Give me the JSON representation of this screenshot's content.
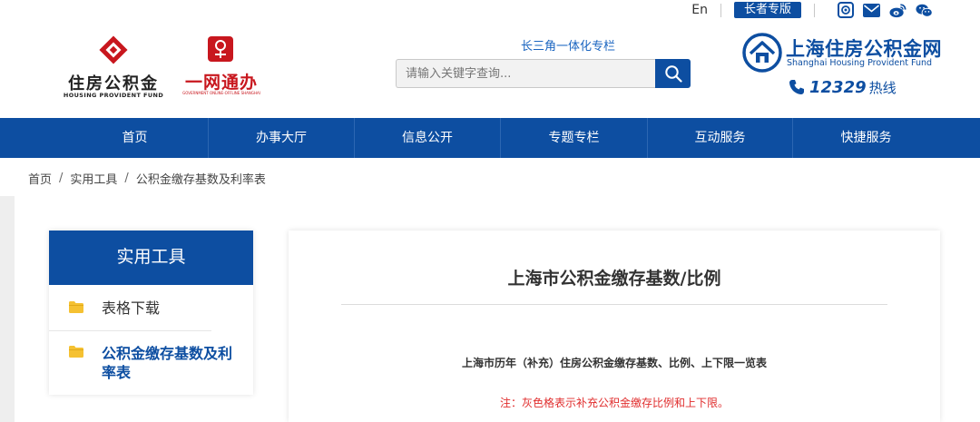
{
  "top_bar": {
    "language_link": "En",
    "elderly_mode_label": "长者专版",
    "icons": [
      "app-icon",
      "mail-icon",
      "weibo-icon",
      "wechat-icon"
    ]
  },
  "header": {
    "left_logo": {
      "cn": "住房公积金",
      "en": "HOUSING PROVIDENT FUND"
    },
    "ywtb_logo": {
      "cn": "一网通办",
      "en": "GOVERNMENT ONLINE-OFFLINE SHANGHAI"
    },
    "yrd_link": "长三角一体化专栏",
    "search": {
      "placeholder": "请输入关键字查询..."
    },
    "right_logo": {
      "cn": "上海住房公积金网",
      "en": "Shanghai Housing Provident Fund"
    },
    "hotline": {
      "number": "12329",
      "label": "热线"
    }
  },
  "nav": {
    "items": [
      "首页",
      "办事大厅",
      "信息公开",
      "专题专栏",
      "互动服务",
      "快捷服务"
    ]
  },
  "breadcrumb": {
    "items": [
      "首页",
      "实用工具",
      "公积金缴存基数及利率表"
    ],
    "separator": "/"
  },
  "sidebar": {
    "title": "实用工具",
    "items": [
      {
        "label": "表格下载",
        "active": false
      },
      {
        "label": "公积金缴存基数及利率表",
        "active": true
      }
    ]
  },
  "main": {
    "title": "上海市公积金缴存基数/比例",
    "subtitle": "上海市历年（补充）住房公积金缴存基数、比例、上下限一览表",
    "note": "注：灰色格表示补充公积金缴存比例和上下限。"
  },
  "colors": {
    "brand_blue": "#0d4ea1",
    "link_blue": "#1a65c0",
    "note_red": "#e02d2d",
    "logo_red": "#c8171e",
    "folder_yellow": "#f5c132"
  }
}
